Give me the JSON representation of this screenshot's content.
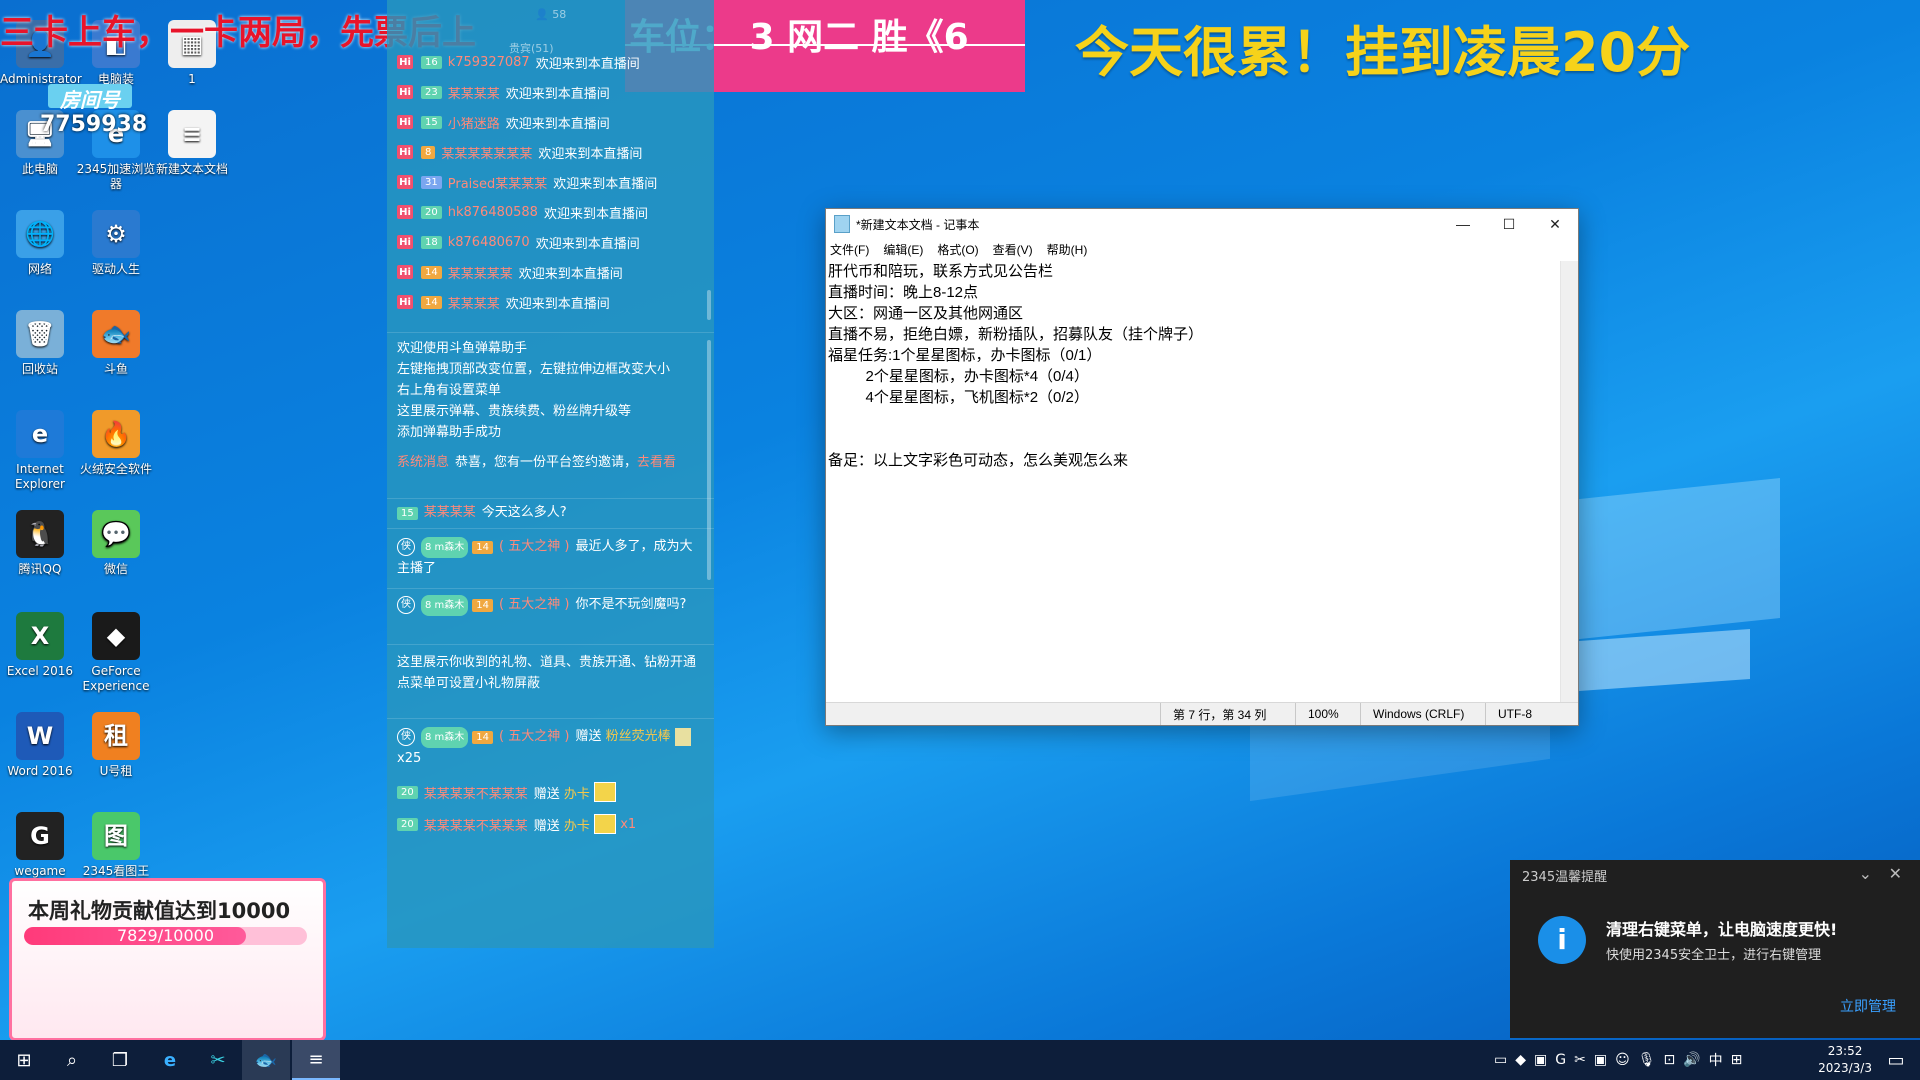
{
  "overlays": {
    "top_red": "三卡上车，一卡两局，先票后上",
    "pink_banner": "车位： 3  网二  胜《6",
    "yellow": "今天很累！挂到凌晨20分",
    "room_label": "房间号",
    "room_number": "7759938"
  },
  "desktop": {
    "icons": [
      {
        "label": "Administrator",
        "glyph": "👤"
      },
      {
        "label": "电脑装",
        "glyph": "◧"
      },
      {
        "label": "1",
        "glyph": "▦"
      },
      {
        "label": "此电脑",
        "glyph": "🖥"
      },
      {
        "label": "2345加速浏览器",
        "glyph": "e"
      },
      {
        "label": "新建文本文档",
        "glyph": "≡"
      },
      {
        "label": "网络",
        "glyph": "🌐"
      },
      {
        "label": "驱动人生",
        "glyph": "⚙"
      },
      {
        "label": "回收站",
        "glyph": "🗑"
      },
      {
        "label": "斗鱼",
        "glyph": "🐟"
      },
      {
        "label": "Internet Explorer",
        "glyph": "e"
      },
      {
        "label": "火绒安全软件",
        "glyph": "🔥"
      },
      {
        "label": "腾讯QQ",
        "glyph": "🐧"
      },
      {
        "label": "微信",
        "glyph": "💬"
      },
      {
        "label": "Excel 2016",
        "glyph": "X"
      },
      {
        "label": "GeForce Experience",
        "glyph": "◆"
      },
      {
        "label": "Word 2016",
        "glyph": "W"
      },
      {
        "label": "U号租",
        "glyph": "租"
      },
      {
        "label": "wegame",
        "glyph": "G"
      },
      {
        "label": "2345看图王",
        "glyph": "图"
      }
    ]
  },
  "chat": {
    "header": {
      "nobles": "贵宾(51)",
      "count": "58"
    },
    "join_text": "欢迎来到本直播间",
    "join_rows": [
      {
        "level": "16",
        "color": "g",
        "name": "k759327087"
      },
      {
        "level": "23",
        "color": "g",
        "name": "某某某某"
      },
      {
        "level": "15",
        "color": "g",
        "name": "小猪迷路"
      },
      {
        "level": "8",
        "color": "o",
        "name": "某某某某某某某"
      },
      {
        "level": "31",
        "color": "b",
        "name": "Praised某某某某"
      },
      {
        "level": "20",
        "color": "g",
        "name": "hk876480588"
      },
      {
        "level": "18",
        "color": "g",
        "name": "k876480670"
      },
      {
        "level": "14",
        "color": "o",
        "name": "某某某某某"
      },
      {
        "level": "14",
        "color": "o",
        "name": "某某某某"
      }
    ],
    "system_lines": [
      "欢迎使用斗鱼弹幕助手",
      "左键拖拽顶部改变位置，左键拉伸边框改变大小",
      "右上角有设置菜单",
      "这里展示弹幕、贵族续费、粉丝牌升级等",
      "添加弹幕助手成功"
    ],
    "invite": {
      "name": "系统消息",
      "text": "恭喜，您有一份平台签约邀请，",
      "link": "去看看"
    },
    "msg1": {
      "level": "15",
      "name": "某某某某",
      "text": "今天这么多人?"
    },
    "msg2": {
      "fan": "8 m森木",
      "level": "14",
      "name": "( 五大之神 )",
      "text": "最近人多了，成为大主播了"
    },
    "msg3": {
      "fan": "8 m森木",
      "level": "14",
      "name": "( 五大之神 )",
      "text": "你不是不玩剑魔吗?"
    },
    "gift_notice": [
      "这里展示你收到的礼物、道具、贵族开通、钻粉开通",
      "点菜单可设置小礼物屏蔽"
    ],
    "gift1": {
      "fan": "8 m森木",
      "level": "14",
      "name": "( 五大之神 )",
      "verb": "赠送",
      "item": "粉丝荧光棒",
      "count": "x25"
    },
    "gift2": {
      "level": "20",
      "name": "某某某某不某某某",
      "verb": "赠送",
      "item": "办卡"
    },
    "gift3": {
      "level": "20",
      "name": "某某某某不某某某",
      "verb": "赠送",
      "item": "办卡",
      "tail": "x1"
    }
  },
  "notepad": {
    "title": "*新建文本文档 - 记事本",
    "menu": [
      "文件(F)",
      "编辑(E)",
      "格式(O)",
      "查看(V)",
      "帮助(H)"
    ],
    "content": "肝代币和陪玩，联系方式见公告栏\n直播时间：晚上8-12点\n大区：网通一区及其他网通区\n直播不易，拒绝白嫖，新粉插队，招募队友（挂个牌子）\n福星任务:1个星星图标，办卡图标（0/1）\n         2个星星图标，办卡图标*4（0/4）\n         4个星星图标，飞机图标*2（0/2）\n\n\n备足：以上文字彩色可动态，怎么美观怎么来",
    "status": [
      "第 7 行，第 34 列",
      "100%",
      "Windows (CRLF)",
      "UTF-8"
    ]
  },
  "gift_panel": {
    "title": "本周礼物贡献值达到10000",
    "progress_text": "7829/10000",
    "progress": 0.7829
  },
  "toast": {
    "header": "2345温馨提醒",
    "title": "清理右键菜单，让电脑速度更快!",
    "body": "快使用2345安全卫士，进行右键管理",
    "link": "立即管理"
  },
  "taskbar": {
    "time": "23:52",
    "date": "2023/3/3",
    "ime": "中"
  }
}
